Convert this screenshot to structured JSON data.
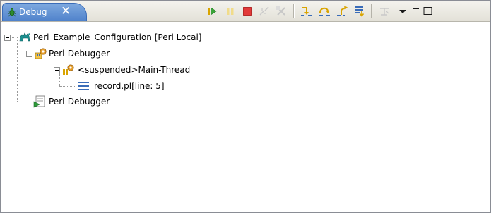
{
  "view": {
    "tab_label": "Debug",
    "tab_icon": "debug-bug-icon",
    "tab_close": "✕"
  },
  "toolbar": {
    "buttons": [
      {
        "name": "resume-icon",
        "enabled": true
      },
      {
        "name": "suspend-icon",
        "enabled": false
      },
      {
        "name": "terminate-icon",
        "enabled": true
      },
      {
        "name": "disconnect-icon",
        "enabled": false
      },
      {
        "name": "remove-terminated-icon",
        "enabled": false
      },
      {
        "name": "step-into-icon",
        "enabled": true
      },
      {
        "name": "step-over-icon",
        "enabled": true
      },
      {
        "name": "step-return-icon",
        "enabled": true
      },
      {
        "name": "drop-to-frame-icon",
        "enabled": true
      },
      {
        "name": "use-step-filters-icon",
        "enabled": false
      },
      {
        "name": "view-menu-icon",
        "enabled": true
      },
      {
        "name": "minimize-icon",
        "enabled": true
      },
      {
        "name": "maximize-icon",
        "enabled": true
      }
    ]
  },
  "tree": {
    "launch": {
      "label": "Perl_Example_Configuration [Perl Local]",
      "icon": "perl-camel-icon",
      "expanded": true
    },
    "debug_target": {
      "label": "Perl-Debugger",
      "icon": "debug-target-icon",
      "expanded": true
    },
    "thread": {
      "label": "<suspended>Main-Thread",
      "icon": "suspended-thread-icon",
      "expanded": true
    },
    "stack_frame": {
      "label": "record.pl[line: 5]",
      "icon": "stack-frame-icon"
    },
    "process": {
      "label": "Perl-Debugger",
      "icon": "process-icon"
    }
  }
}
